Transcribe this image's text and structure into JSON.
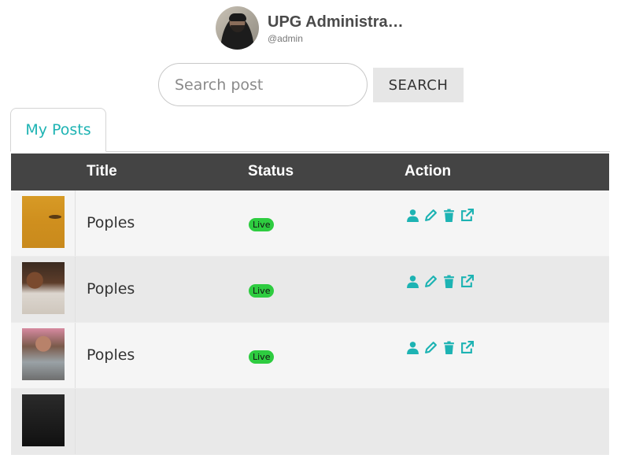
{
  "profile": {
    "name": "UPG Administra…",
    "handle": "@admin"
  },
  "search": {
    "placeholder": "Search post",
    "value": "",
    "button_label": "SEARCH"
  },
  "tabs": [
    {
      "label": "My Posts",
      "active": true
    }
  ],
  "table": {
    "columns": [
      "",
      "Title",
      "Status",
      "Action"
    ],
    "rows": [
      {
        "title": "Poples",
        "status": "Live"
      },
      {
        "title": "Poples",
        "status": "Live"
      },
      {
        "title": "Poples",
        "status": "Live"
      },
      {
        "title": "",
        "status": ""
      }
    ],
    "actions": [
      "user-icon",
      "pencil-icon",
      "trash-icon",
      "external-link-icon"
    ]
  },
  "colors": {
    "accent": "#1db3b3",
    "header_bg": "#444444",
    "live_badge": "#2ecc40"
  }
}
